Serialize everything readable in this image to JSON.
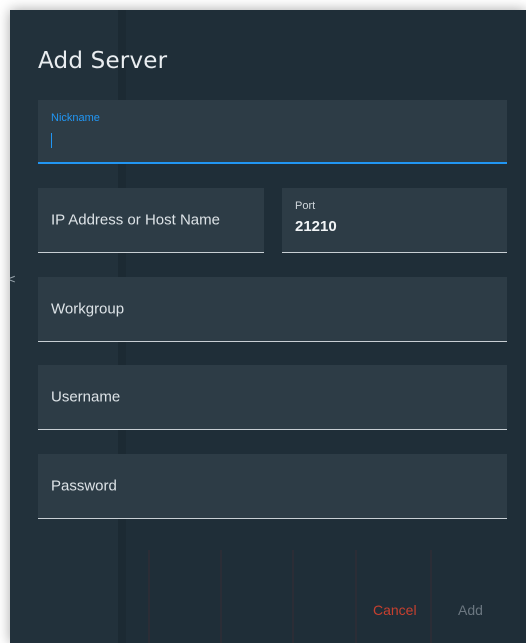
{
  "dialog": {
    "title": "Add Server",
    "side_mark": "<"
  },
  "fields": {
    "nickname": {
      "label": "Nickname",
      "value": "",
      "focused": true
    },
    "host": {
      "placeholder": "IP Address or Host Name"
    },
    "port": {
      "label": "Port",
      "value": "21210"
    },
    "workgroup": {
      "placeholder": "Workgroup"
    },
    "username": {
      "placeholder": "Username"
    },
    "password": {
      "placeholder": "Password"
    }
  },
  "actions": {
    "cancel_label": "Cancel",
    "add_label": "Add"
  },
  "colors": {
    "dialog_bg": "#1f2e38",
    "field_bg": "#2d3c46",
    "focus_accent": "#2196f3",
    "cancel": "#c7402f",
    "add_disabled": "#6b7780"
  }
}
